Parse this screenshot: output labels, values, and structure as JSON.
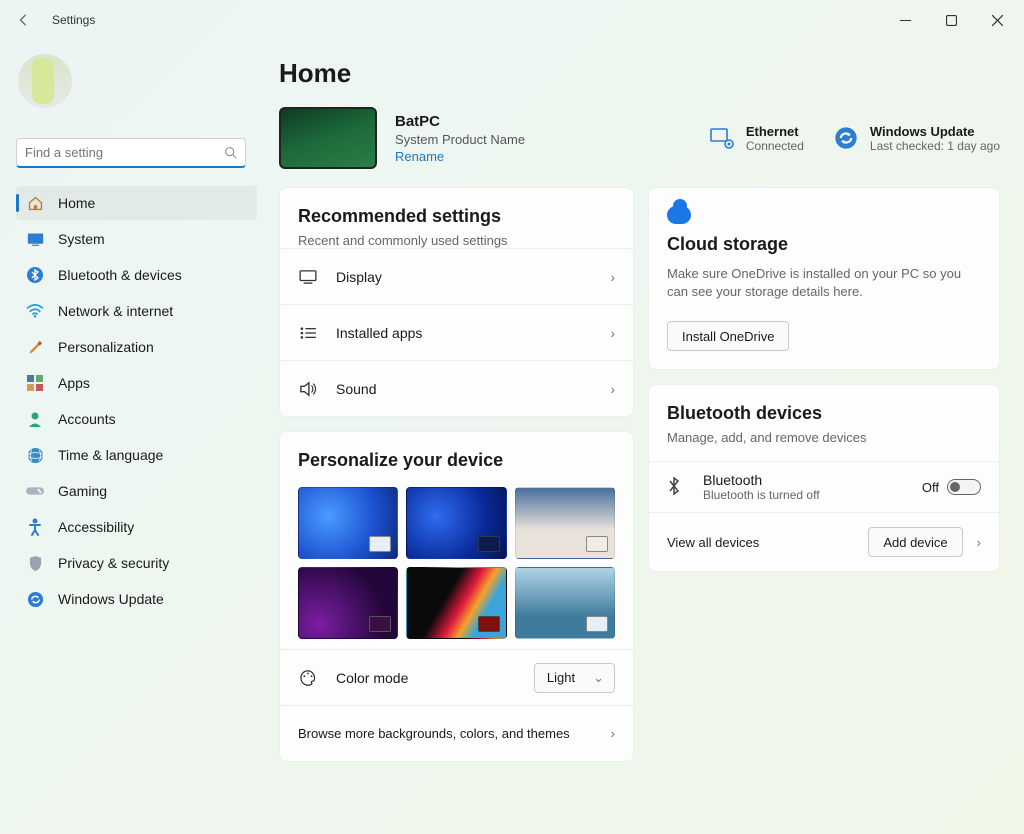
{
  "window": {
    "title": "Settings"
  },
  "search": {
    "placeholder": "Find a setting"
  },
  "nav": [
    {
      "id": "home",
      "label": "Home"
    },
    {
      "id": "system",
      "label": "System"
    },
    {
      "id": "bluetooth",
      "label": "Bluetooth & devices"
    },
    {
      "id": "network",
      "label": "Network & internet"
    },
    {
      "id": "personalization",
      "label": "Personalization"
    },
    {
      "id": "apps",
      "label": "Apps"
    },
    {
      "id": "accounts",
      "label": "Accounts"
    },
    {
      "id": "time",
      "label": "Time & language"
    },
    {
      "id": "gaming",
      "label": "Gaming"
    },
    {
      "id": "accessibility",
      "label": "Accessibility"
    },
    {
      "id": "privacy",
      "label": "Privacy & security"
    },
    {
      "id": "update",
      "label": "Windows Update"
    }
  ],
  "page": {
    "title": "Home"
  },
  "device": {
    "name": "BatPC",
    "product": "System Product Name",
    "rename": "Rename"
  },
  "status": {
    "ethernet": {
      "title": "Ethernet",
      "sub": "Connected"
    },
    "update": {
      "title": "Windows Update",
      "sub": "Last checked: 1 day ago"
    }
  },
  "recommended": {
    "title": "Recommended settings",
    "sub": "Recent and commonly used settings",
    "items": [
      "Display",
      "Installed apps",
      "Sound"
    ]
  },
  "personalize": {
    "title": "Personalize your device",
    "color_mode_label": "Color mode",
    "color_mode_value": "Light",
    "browse": "Browse more backgrounds, colors, and themes"
  },
  "cloud": {
    "title": "Cloud storage",
    "desc": "Make sure OneDrive is installed on your PC so you can see your storage details here.",
    "button": "Install OneDrive"
  },
  "bluetooth": {
    "title": "Bluetooth devices",
    "sub": "Manage, add, and remove devices",
    "row_title": "Bluetooth",
    "row_sub": "Bluetooth is turned off",
    "toggle_state": "Off",
    "view_all": "View all devices",
    "add": "Add device"
  }
}
